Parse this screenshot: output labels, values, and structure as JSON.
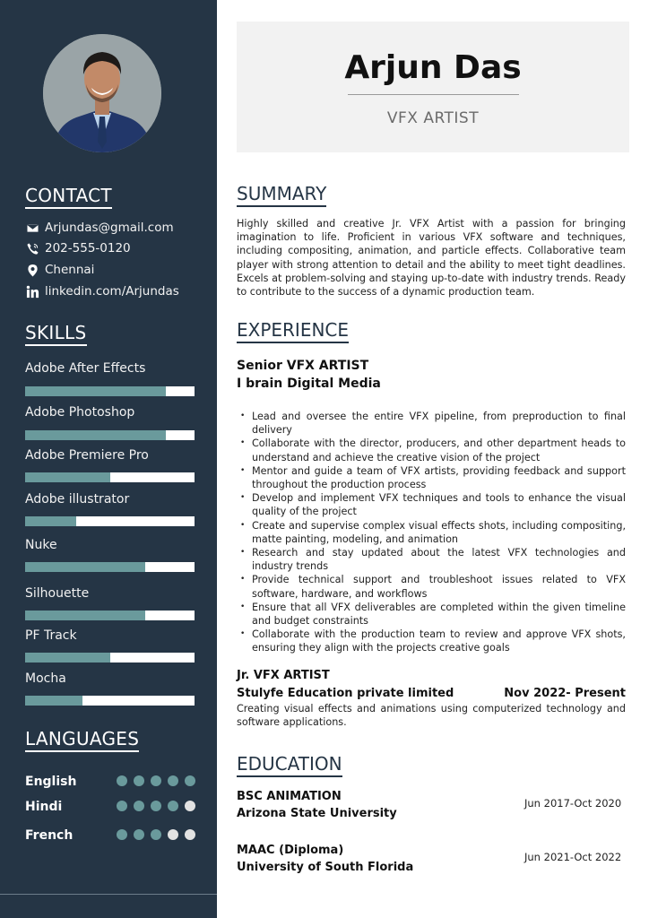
{
  "profile": {
    "name": "Arjun Das",
    "role": "VFX ARTIST",
    "photo_alt": "Portrait of Arjun Das"
  },
  "colors": {
    "sidebar_bg": "#253545",
    "accent": "#6a9a9c",
    "inactive": "#e2e2e2",
    "header_bg": "#f2f2f2"
  },
  "contact": {
    "heading": "CONTACT",
    "items": [
      {
        "icon": "envelope-icon",
        "text": "Arjundas@gmail.com"
      },
      {
        "icon": "phone-icon",
        "text": "202-555-0120"
      },
      {
        "icon": "location-pin-icon",
        "text": "Chennai"
      },
      {
        "icon": "linkedin-icon",
        "text": "linkedin.com/Arjundas"
      }
    ]
  },
  "skills": {
    "heading": "SKILLS",
    "items": [
      {
        "name": "Adobe After Effects",
        "level": 0.83
      },
      {
        "name": "Adobe Photoshop",
        "level": 0.83
      },
      {
        "name": "Adobe Premiere Pro",
        "level": 0.5
      },
      {
        "name": "Adobe illustrator",
        "level": 0.3
      },
      {
        "name": "Nuke",
        "level": 0.71
      },
      {
        "name": "Silhouette",
        "level": 0.71
      },
      {
        "name": "PF Track",
        "level": 0.5
      },
      {
        "name": "Mocha",
        "level": 0.34
      }
    ]
  },
  "languages": {
    "heading": "LANGUAGES",
    "max": 5,
    "items": [
      {
        "name": "English",
        "level": 5
      },
      {
        "name": "Hindi",
        "level": 4
      },
      {
        "name": "French",
        "level": 3
      }
    ]
  },
  "summary": {
    "heading": "SUMMARY",
    "text": "Highly skilled and creative Jr. VFX Artist with a passion for bringing imagination to life. Proficient in various VFX software and techniques, including compositing, animation, and particle effects. Collaborative team player with strong attention to detail and the ability to meet tight deadlines. Excels at problem-solving and staying up-to-date with industry trends. Ready to contribute to the success of a dynamic production team."
  },
  "experience": {
    "heading": "EXPERIENCE",
    "jobs": [
      {
        "title": "Senior VFX ARTIST",
        "company": "I brain Digital Media",
        "bullets": [
          "Lead and oversee the entire VFX pipeline, from preproduction to final delivery",
          "Collaborate with the director, producers, and other department heads to understand and achieve the creative vision of the project",
          "Mentor and guide a team of VFX artists, providing feedback and support throughout the production process",
          "Develop and implement VFX techniques and tools to enhance the visual quality of the project",
          "Create and supervise complex visual effects shots, including compositing, matte painting, modeling, and animation",
          "Research and stay updated about the latest VFX technologies and industry trends",
          "Provide technical support and troubleshoot issues related to VFX software, hardware, and workflows",
          "Ensure that all VFX deliverables are completed within the given timeline and budget constraints",
          "Collaborate with the production team to review and approve VFX shots, ensuring they align with the projects creative goals"
        ]
      },
      {
        "title": "Jr. VFX ARTIST",
        "company": "Stulyfe Education private limited",
        "dates": "Nov 2022- Present",
        "description": "Creating visual effects and animations using computerized technology and software applications."
      }
    ]
  },
  "education": {
    "heading": "EDUCATION",
    "items": [
      {
        "degree": "BSC ANIMATION",
        "school": "Arizona State University",
        "dates": "Jun 2017-Oct 2020"
      },
      {
        "degree": "MAAC (Diploma)",
        "school": "University of South Florida",
        "dates": "Jun 2021-Oct 2022"
      }
    ]
  }
}
